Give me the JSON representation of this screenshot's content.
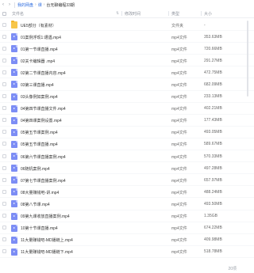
{
  "breadcrumb": {
    "back_icon": "chevron-left-icon",
    "forward_icon": "chevron-right-icon",
    "items": [
      "我的网盘",
      "课",
      "台无聊编程33期"
    ],
    "separator": "›"
  },
  "columns": {
    "name": "文件名",
    "modified": "修改时间",
    "type": "类型",
    "size": "大小"
  },
  "rows": [
    {
      "name": "UE5部分（有素材）",
      "type": "文件夹",
      "size": "-",
      "icon": "folder-icon"
    },
    {
      "name": "01案例浮现1:遭遇.mp4",
      "type": "mp4文件",
      "size": "353.63MB",
      "icon": "video-file-icon"
    },
    {
      "name": "01第一节课直播.mp4",
      "type": "mp4文件",
      "size": "720.66MB",
      "icon": "video-file-icon"
    },
    {
      "name": "02关卡编辑器 .mp4",
      "type": "mp4文件",
      "size": "291.27MB",
      "icon": "video-file-icon"
    },
    {
      "name": "02第二节课直播内容.mp4",
      "type": "mp4文件",
      "size": "472.75MB",
      "icon": "video-file-icon"
    },
    {
      "name": "03第三课直播.mp4",
      "type": "mp4文件",
      "size": "682.09MB",
      "icon": "video-file-icon"
    },
    {
      "name": "03头像例如案例.mp4",
      "type": "mp4文件",
      "size": "233.13MB",
      "icon": "video-file-icon"
    },
    {
      "name": "04第四节课直播文件.mp4",
      "type": "mp4文件",
      "size": "402.21MB",
      "icon": "video-file-icon"
    },
    {
      "name": "04第四课案例设置.mp4",
      "type": "mp4文件",
      "size": "177.43MB",
      "icon": "video-file-icon"
    },
    {
      "name": "05第五节课案例.mp4",
      "type": "mp4文件",
      "size": "493.05MB",
      "icon": "video-file-icon"
    },
    {
      "name": "05第五节课直播.mp4",
      "type": "mp4文件",
      "size": "589.67MB",
      "icon": "video-file-icon"
    },
    {
      "name": "06第六节课直播案例.mp4",
      "type": "mp4文件",
      "size": "570.33MB",
      "icon": "video-file-icon"
    },
    {
      "name": "06随机案例.mp4",
      "type": "mp4文件",
      "size": "497.28MB",
      "icon": "video-file-icon"
    },
    {
      "name": "07第七节课直播案例.mp4",
      "type": "mp4文件",
      "size": "657.97MB",
      "icon": "video-file-icon"
    },
    {
      "name": "08大量赚钱吧-讲.mp4",
      "type": "mp4文件",
      "size": "488.24MB",
      "icon": "video-file-icon"
    },
    {
      "name": "08第八节课.mp4",
      "type": "mp4文件",
      "size": "493.50MB",
      "icon": "video-file-icon"
    },
    {
      "name": "09第九课收放直播案例.mp4",
      "type": "mp4文件",
      "size": "1.35GB",
      "icon": "video-file-icon"
    },
    {
      "name": "10第十节课直播.mp4",
      "type": "mp4文件",
      "size": "674.22MB",
      "icon": "video-file-icon"
    },
    {
      "name": "11大量赚钱吧-MD播链上.mp4",
      "type": "mp4文件",
      "size": "409.98MB",
      "icon": "video-file-icon"
    },
    {
      "name": "11大量赚钱吧-MD播链下.mp4",
      "type": "mp4文件",
      "size": "518.78MB",
      "icon": "video-file-icon"
    }
  ],
  "footer": {
    "count": "20项"
  }
}
